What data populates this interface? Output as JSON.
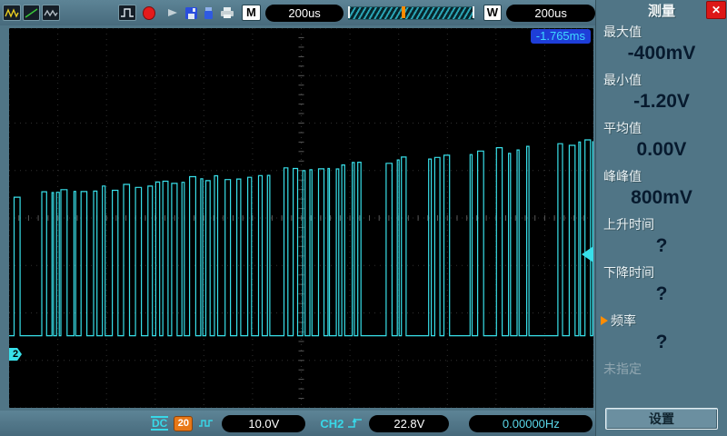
{
  "topbar": {
    "timebase_badge": "M",
    "timebase_value": "200us",
    "window_badge": "W",
    "window_value": "200us"
  },
  "scope": {
    "time_offset": "-1.765ms",
    "channel_marker": "2"
  },
  "waveform": {
    "color": "#38e0ea",
    "seed": 20240412,
    "baseline_frac": 0.81,
    "top_start_frac": 0.445,
    "top_end_frac": 0.3,
    "grid_cols": 12,
    "grid_rows": 8
  },
  "sidebar": {
    "title": "测量",
    "items": [
      {
        "label": "最大值",
        "value": "-400mV"
      },
      {
        "label": "最小值",
        "value": "-1.20V"
      },
      {
        "label": "平均值",
        "value": "0.00V"
      },
      {
        "label": "峰峰值",
        "value": "800mV"
      },
      {
        "label": "上升时间",
        "value": "?"
      },
      {
        "label": "下降时间",
        "value": "?"
      },
      {
        "label": "频率",
        "value": "?"
      },
      {
        "label": "未指定",
        "value": ""
      }
    ],
    "settings_button": "设置"
  },
  "statusbar": {
    "coupling": "DC",
    "bandwidth_badge": "20",
    "volts_per_div": "10.0V",
    "channel_label": "CH2",
    "trigger_level": "22.8V",
    "frequency_counter": "0.00000Hz"
  }
}
